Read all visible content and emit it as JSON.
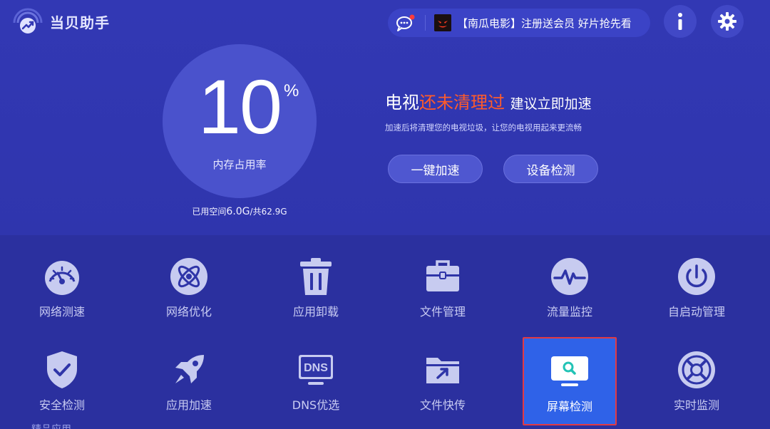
{
  "app": {
    "name": "当贝助手"
  },
  "promo": {
    "text": "【南瓜电影】注册送会员 好片抢先看"
  },
  "header": {
    "info_icon": "info-icon",
    "settings_icon": "gear-icon"
  },
  "memory": {
    "percent": "10",
    "percent_sign": "%",
    "label": "内存占用率",
    "storage_prefix": "已用空间",
    "storage_used": "6.0G",
    "storage_total": "/共62.9G"
  },
  "status": {
    "title_prefix": "电视",
    "title_highlight": "还未清理过",
    "title_suffix": "建议立即加速",
    "subtitle": "加速后将清理您的电视垃圾，让您的电视用起来更流畅",
    "accent_color": "#ff5b2a"
  },
  "actions": {
    "boost": "一键加速",
    "detect": "设备检测"
  },
  "tools": [
    {
      "label": "网络测速",
      "icon": "speedometer-icon"
    },
    {
      "label": "网络优化",
      "icon": "atom-icon"
    },
    {
      "label": "应用卸载",
      "icon": "trash-icon"
    },
    {
      "label": "文件管理",
      "icon": "toolbox-icon"
    },
    {
      "label": "流量监控",
      "icon": "pulse-icon"
    },
    {
      "label": "自启动管理",
      "icon": "power-icon"
    },
    {
      "label": "安全检测",
      "icon": "shield-check-icon"
    },
    {
      "label": "应用加速",
      "icon": "rocket-icon"
    },
    {
      "label": "DNS优选",
      "icon": "dns-icon",
      "icon_text": "DNS"
    },
    {
      "label": "文件快传",
      "icon": "folder-transfer-icon"
    },
    {
      "label": "屏幕检测",
      "icon": "monitor-search-icon",
      "selected": true
    },
    {
      "label": "实时监测",
      "icon": "lifebuoy-icon"
    }
  ],
  "section": {
    "featured": "精品应用"
  },
  "colors": {
    "background": "#2f35a8",
    "selected_tile": "#2f62e8",
    "selected_border": "#e23a43"
  }
}
